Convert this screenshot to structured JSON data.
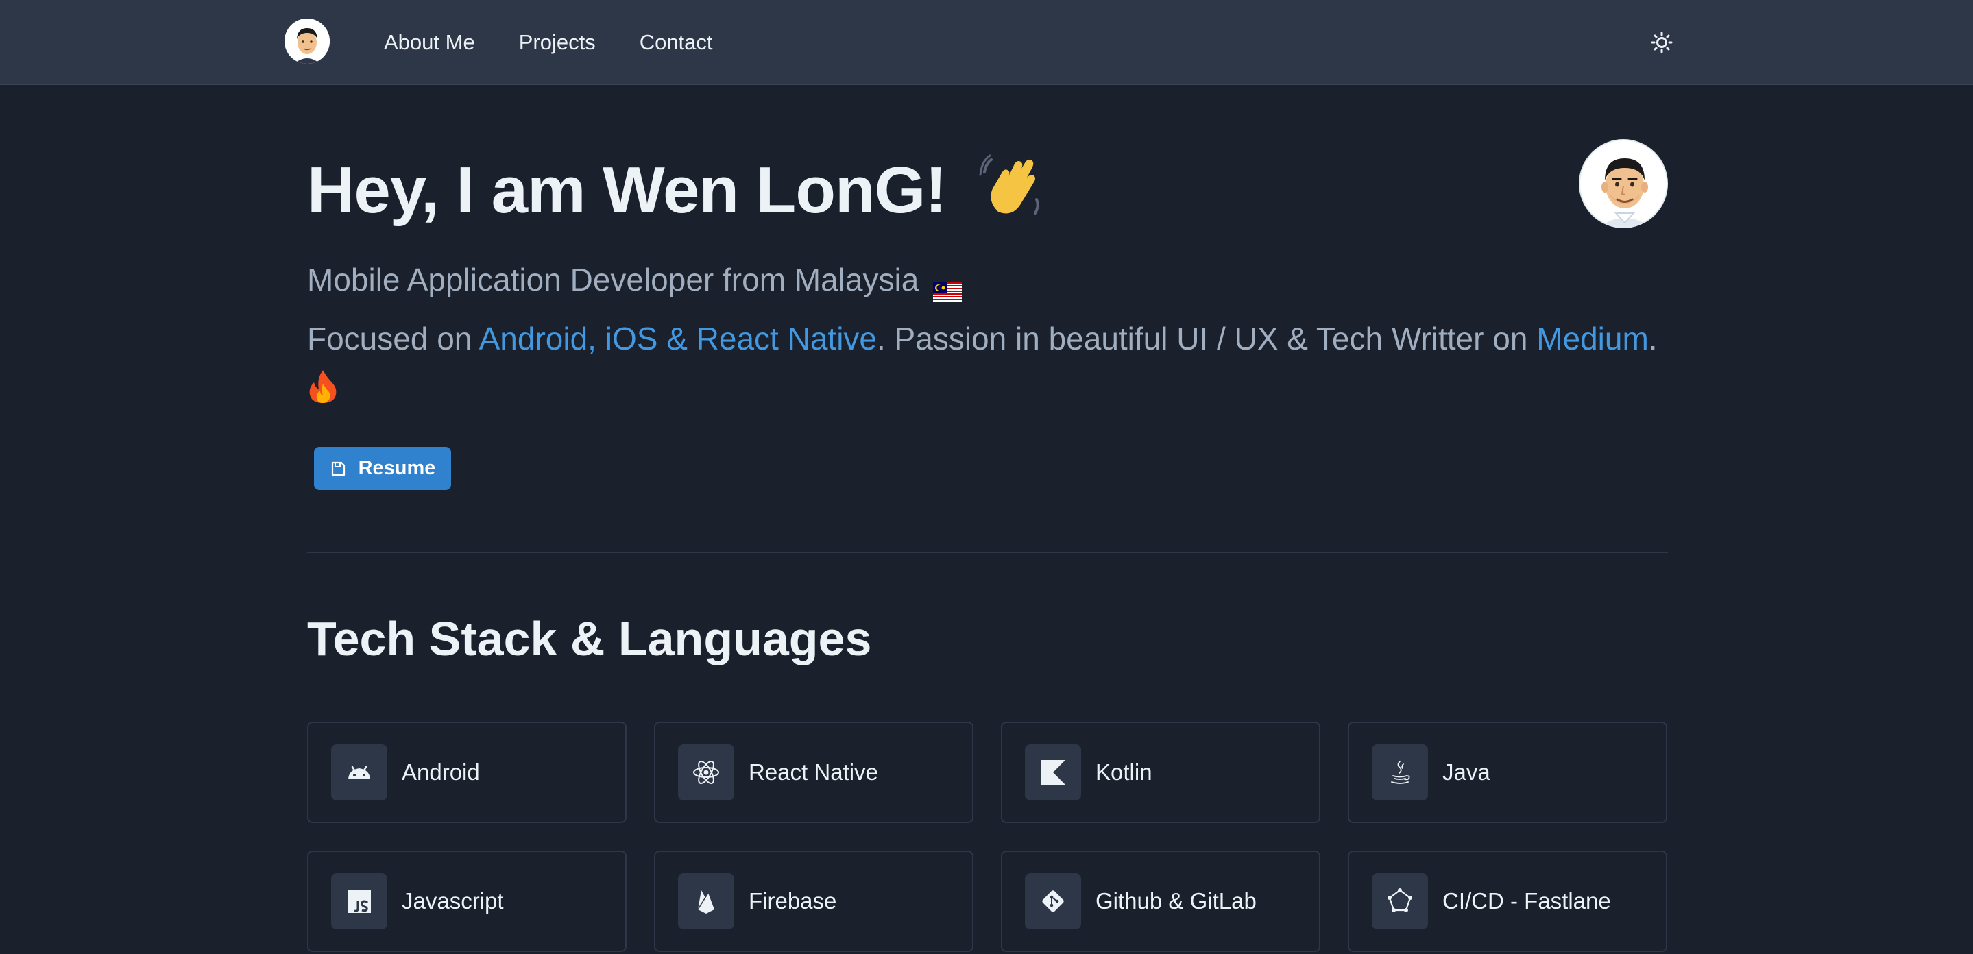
{
  "nav": {
    "links": [
      "About Me",
      "Projects",
      "Contact"
    ],
    "avatar_icon": "memoji-avatar",
    "theme_toggle_icon": "sun-icon"
  },
  "hero": {
    "greeting": "Hey, I am Wen LonG!",
    "greeting_emoji": "👋",
    "subtitle": "Mobile Application Developer from Malaysia",
    "focus_prefix": "Focused on ",
    "focus_link": "Android, iOS & React Native",
    "focus_middle": ". Passion in beautiful UI / UX & Tech Writter on ",
    "medium_link": "Medium",
    "focus_suffix": ".",
    "fire_emoji": "🔥",
    "resume_label": "Resume"
  },
  "tech_stack": {
    "title": "Tech Stack & Languages",
    "items": [
      {
        "label": "Android",
        "icon": "android-icon"
      },
      {
        "label": "React Native",
        "icon": "react-icon"
      },
      {
        "label": "Kotlin",
        "icon": "kotlin-icon"
      },
      {
        "label": "Java",
        "icon": "java-icon"
      },
      {
        "label": "Javascript",
        "icon": "javascript-icon"
      },
      {
        "label": "Firebase",
        "icon": "firebase-icon"
      },
      {
        "label": "Github & GitLab",
        "icon": "git-icon"
      },
      {
        "label": "CI/CD - Fastlane",
        "icon": "fastlane-icon"
      }
    ]
  },
  "colors": {
    "background": "#1a202c",
    "navbar": "#2d3748",
    "accent": "#4299e1",
    "button": "#3182ce",
    "text": "#edf2f7",
    "muted": "#a0aec0"
  }
}
